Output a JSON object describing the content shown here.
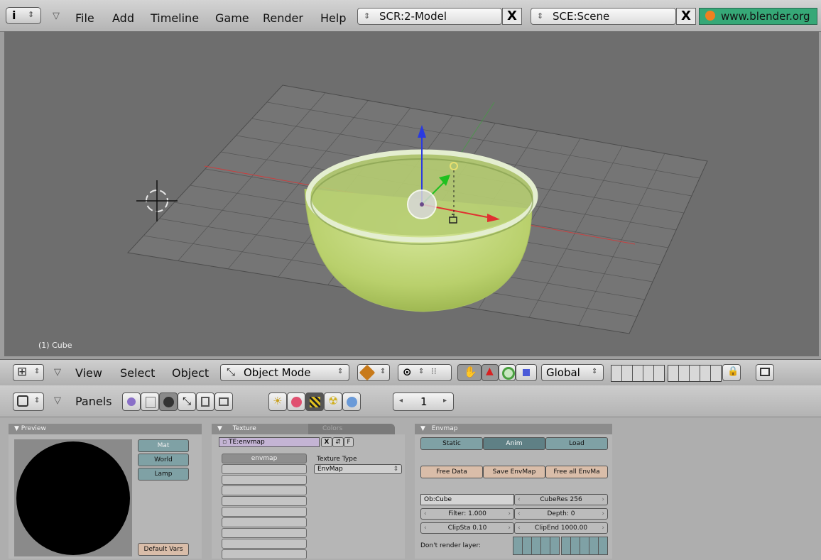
{
  "topbar": {
    "menus": [
      "File",
      "Add",
      "Timeline",
      "Game",
      "Render",
      "Help"
    ],
    "screen_field": "SCR:2-Model",
    "scene_field": "SCE:Scene",
    "url": "www.blender.org",
    "close_glyph": "X"
  },
  "viewport": {
    "object_label": "(1) Cube"
  },
  "view3d_header": {
    "menus": [
      "View",
      "Select",
      "Object"
    ],
    "mode": "Object Mode",
    "orientation": "Global"
  },
  "buttons_header": {
    "panels_label": "Panels",
    "frame": "1"
  },
  "preview_panel": {
    "title": "Preview",
    "buttons": [
      "Mat",
      "World",
      "Lamp"
    ],
    "default_vars": "Default Vars"
  },
  "texture_panel": {
    "tab_texture": "Texture",
    "tab_colors": "Colors",
    "tex_name": "TE:envmap",
    "tex_btns": [
      "X",
      "F"
    ],
    "list_item": "envmap",
    "type_label": "Texture Type",
    "type_value": "EnvMap"
  },
  "envmap_panel": {
    "title": "Envmap",
    "mode_buttons": [
      "Static",
      "Anim",
      "Load"
    ],
    "action_buttons": [
      "Free Data",
      "Save EnvMap",
      "Free all EnvMa"
    ],
    "ob_field": "Ob:Cube",
    "cuberes": "CubeRes 256",
    "filter": "Filter: 1.000",
    "depth": "Depth: 0",
    "clipsta": "ClipSta 0.10",
    "clipend": "ClipEnd 1000.00",
    "dont_render": "Don't render layer:"
  },
  "colors": {
    "viewport_bg": "#6e6e6e",
    "grid": "#4c4c4c",
    "x_axis": "#e03030",
    "y_axis": "#20c020",
    "z_axis": "#2a3ae0",
    "bowl": "#c8dd8a",
    "panel_teal": "#7fa1a5",
    "panel_salmon": "#d9bda9"
  }
}
